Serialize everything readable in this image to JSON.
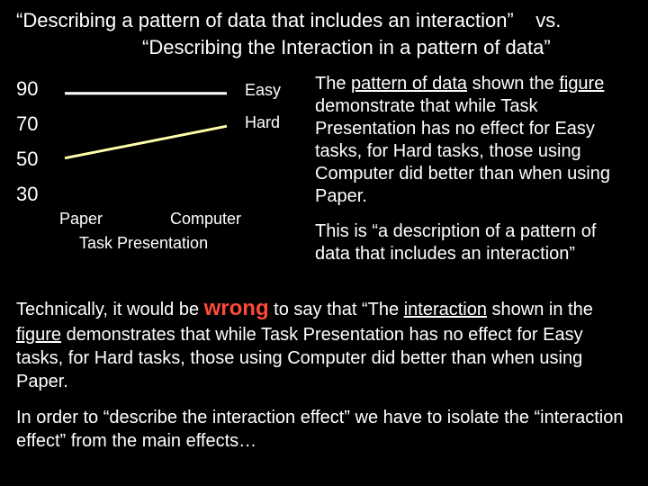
{
  "heading": {
    "quote1": "“Describing a pattern of data that includes an interaction”",
    "vs": "vs.",
    "quote2": "“Describing the Interaction in a pattern of data”"
  },
  "chart_data": {
    "type": "line",
    "categories": [
      "Paper",
      "Computer"
    ],
    "series": [
      {
        "name": "Easy",
        "values": [
          90,
          90
        ]
      },
      {
        "name": "Hard",
        "values": [
          50,
          70
        ]
      }
    ],
    "ylim": [
      30,
      90
    ],
    "yticks": [
      90,
      70,
      50,
      30
    ],
    "xlabel": "Task Presentation",
    "ylabel": "",
    "title": ""
  },
  "para": {
    "p1_a": "The ",
    "p1_u1": "pattern of data",
    "p1_b": " shown the ",
    "p1_u2": "figure",
    "p1_c": " demonstrate that while Task Presentation has no effect for Easy tasks, for Hard tasks, those using Computer did better than when using Paper.",
    "p2": "This is “a description of a pattern of data that includes an interaction”"
  },
  "bottom": {
    "b1_a": "Technically, it would be ",
    "b1_wrong": "wrong",
    "b1_b": " to say that “The ",
    "b1_u1": "interaction",
    "b1_c": " shown in the ",
    "b1_u2": "figure",
    "b1_d": " demonstrates that while Task Presentation has no effect for Easy tasks, for Hard tasks, those using Computer did better than when  using Paper.",
    "b2": "In order to “describe the interaction effect” we have to isolate the “interaction effect” from the main effects…"
  }
}
